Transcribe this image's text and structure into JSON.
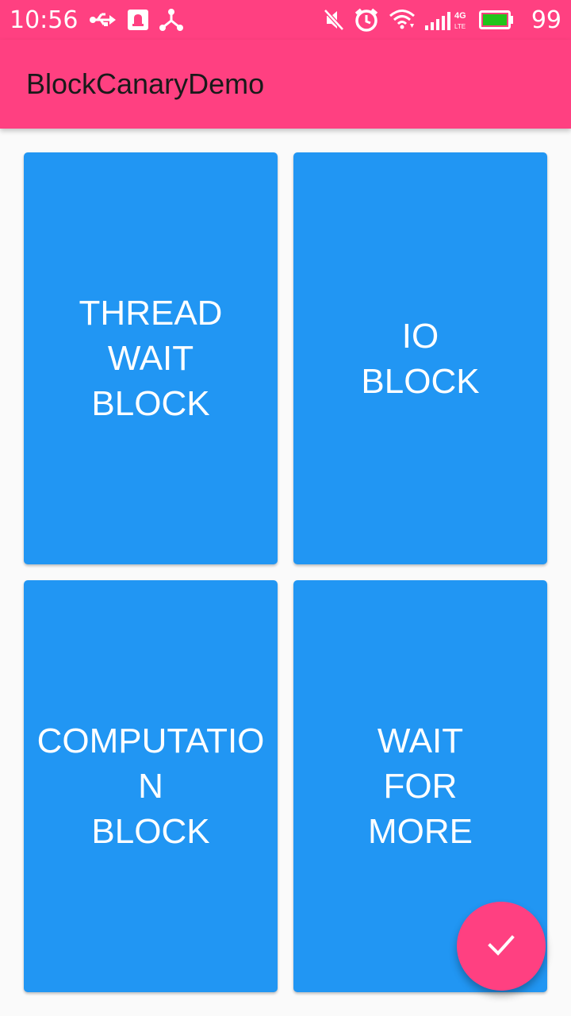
{
  "status_bar": {
    "time": "10:56",
    "battery_level": "99",
    "icons": [
      "usb-icon",
      "notification-icon",
      "share-icon",
      "mute-icon",
      "alarm-icon",
      "wifi-icon",
      "signal-icon",
      "battery-icon"
    ]
  },
  "app_bar": {
    "title": "BlockCanaryDemo"
  },
  "buttons": {
    "thread_wait_block": "THREAD\nWAIT\nBLOCK",
    "io_block": "IO\nBLOCK",
    "computation_block": "COMPUTATIO\nN\nBLOCK",
    "wait_for_more": "WAIT\nFOR\nMORE"
  },
  "fab": {
    "icon": "check-icon"
  },
  "colors": {
    "primary": "#ff4081",
    "button": "#2196f3",
    "background": "#fafafa"
  }
}
